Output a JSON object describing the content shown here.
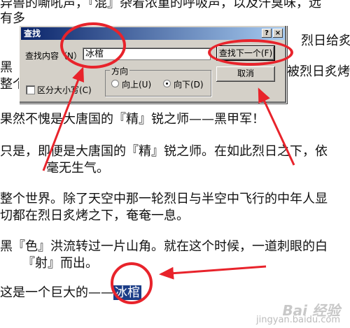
{
  "document": {
    "lines": [
      "异兽的嘶吼声，『混』杂着浓重的呼吸声，以及汗臭味，远",
      "有多",
      "黑『",
      "整个",
      "果然不愧是大唐国的『精』锐之师——黑甲军！",
      "只是，即便是大唐国的『精』锐之师。在如此烈日之下，依",
      "毫无生气。",
      "整个世界。除了天空中那一轮烈日与半空中飞行的中年人显",
      "切都在烈日炙烤之下，奄奄一息。",
      "黑『色』洪流转过一片山角。就在这个时候，一道刺眼的白",
      "『射』而出。",
      "这是一个巨大的——"
    ],
    "right_fragments": [
      "烈日给炙烤",
      "被烈日炙烤"
    ],
    "selected_word": "冰棺"
  },
  "dialog": {
    "title": "查找",
    "help_btn": "?",
    "close_btn": "×",
    "find_label": "查找内容（N）:",
    "find_value": "冰棺",
    "find_next_label": "查找下一个(F)",
    "cancel_label": "取消",
    "match_case_label": "区分大小写(C)",
    "direction_title": "方向",
    "up_label": "向上(U)",
    "down_label": "向下(D)",
    "direction_selected": "down"
  },
  "watermark": {
    "logo": "Bai 经验",
    "url": "jingyan.baidu.com"
  },
  "colors": {
    "annotation": "#e8232b",
    "selection": "#1c3d87",
    "dialog_bg": "#d4d0c8"
  }
}
